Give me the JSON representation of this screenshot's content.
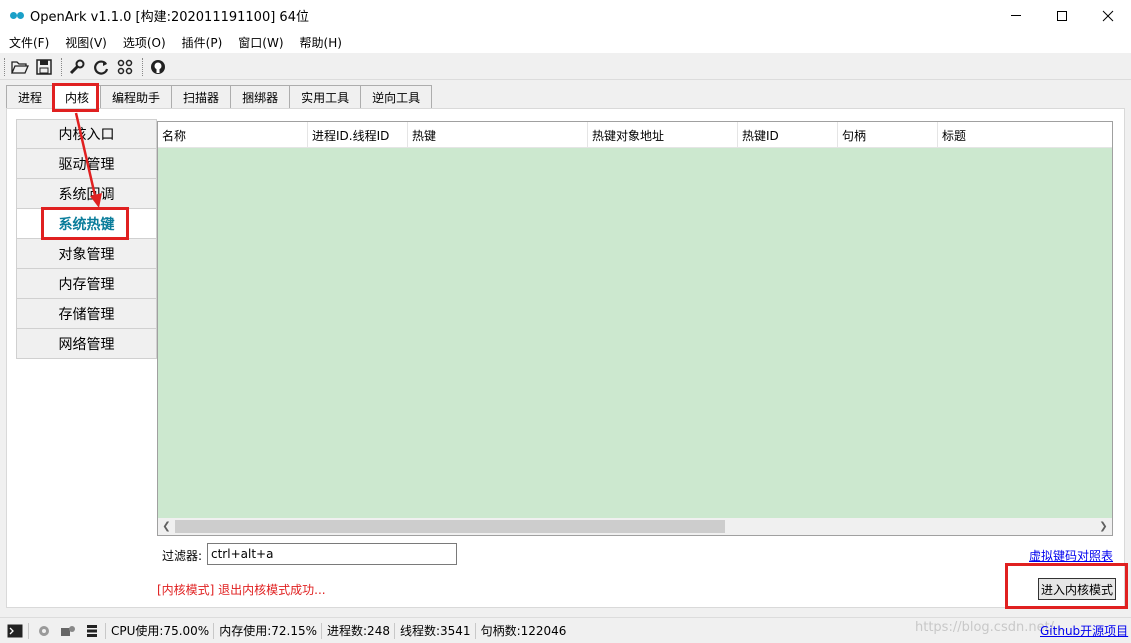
{
  "window": {
    "title": "OpenArk v1.1.0  [构建:202011191100]  64位"
  },
  "menu": [
    {
      "label": "文件(F)"
    },
    {
      "label": "视图(V)"
    },
    {
      "label": "选项(O)"
    },
    {
      "label": "插件(P)"
    },
    {
      "label": "窗口(W)"
    },
    {
      "label": "帮助(H)"
    }
  ],
  "toolbar_icons": [
    "open-folder-icon",
    "save-icon",
    "wrench-icon",
    "refresh-icon",
    "grid-icon",
    "github-icon"
  ],
  "tabs": [
    {
      "label": "进程",
      "active": false
    },
    {
      "label": "内核",
      "active": true
    },
    {
      "label": "编程助手",
      "active": false
    },
    {
      "label": "扫描器",
      "active": false
    },
    {
      "label": "捆绑器",
      "active": false
    },
    {
      "label": "实用工具",
      "active": false
    },
    {
      "label": "逆向工具",
      "active": false
    }
  ],
  "sidebar": [
    {
      "label": "内核入口",
      "active": false
    },
    {
      "label": "驱动管理",
      "active": false
    },
    {
      "label": "系统回调",
      "active": false
    },
    {
      "label": "系统热键",
      "active": true
    },
    {
      "label": "对象管理",
      "active": false
    },
    {
      "label": "内存管理",
      "active": false
    },
    {
      "label": "存储管理",
      "active": false
    },
    {
      "label": "网络管理",
      "active": false
    }
  ],
  "table": {
    "columns": [
      "名称",
      "进程ID.线程ID",
      "热键",
      "热键对象地址",
      "热键ID",
      "句柄",
      "标题"
    ],
    "rows": []
  },
  "filter": {
    "label": "过滤器:",
    "value": "ctrl+alt+a"
  },
  "virtual_key_link": "虚拟键码对照表",
  "status_message": "[内核模式] 退出内核模式成功...",
  "kernel_button": "进入内核模式",
  "statusbar": {
    "cpu": "CPU使用:75.00%",
    "mem": "内存使用:72.15%",
    "procs": "进程数:248",
    "threads": "线程数:3541",
    "handles": "句柄数:122046",
    "github": "Github开源项目"
  },
  "watermark": "https://blog.csdn.net/...",
  "colors": {
    "table_bg": "#cce8cf",
    "active_sidebar_text": "#0b7d9b",
    "highlight": "#e02020",
    "link": "#0000ee"
  }
}
